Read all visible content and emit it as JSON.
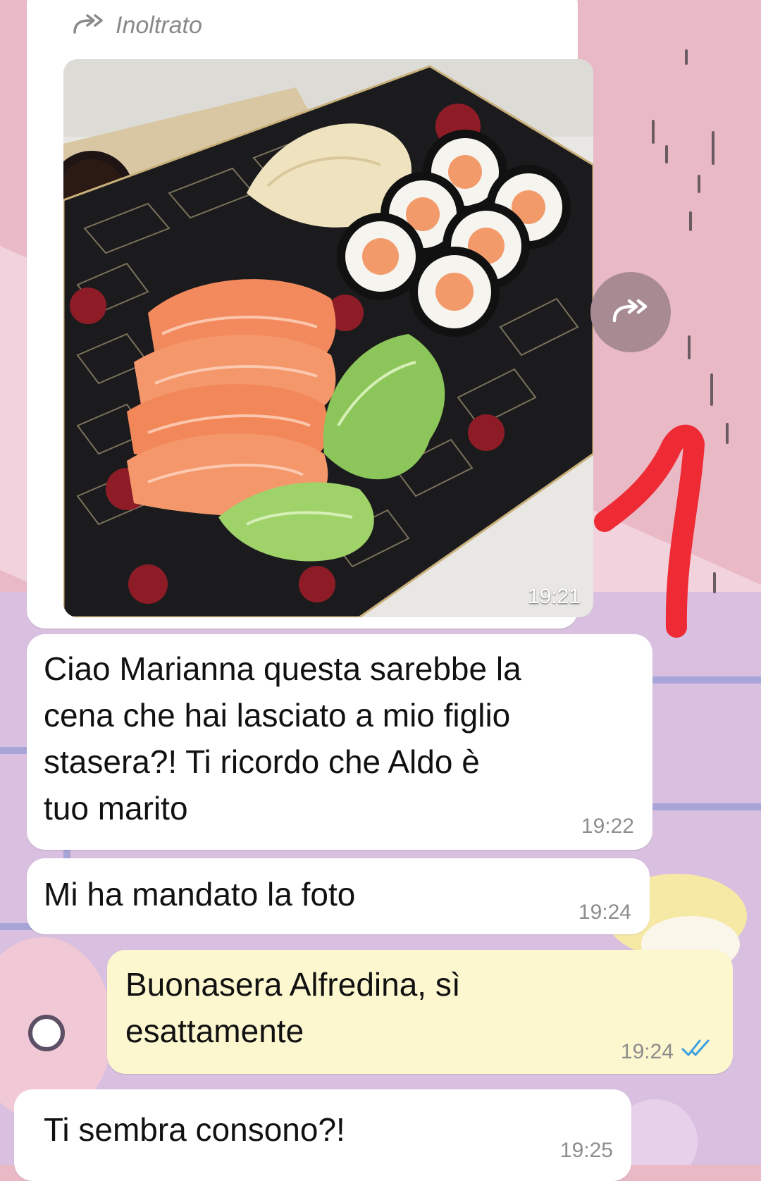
{
  "forwarded": {
    "icon": "forward-icon",
    "label": "Inoltrato",
    "photo_time": "19:21",
    "photo_description_icon": "sushi-photo"
  },
  "forward_button": {
    "icon": "forward-icon"
  },
  "messages": [
    {
      "text": "Ciao Marianna questa sarebbe la\ncena che hai lasciato a mio figlio\nstasera?! Ti ricordo che Aldo è\ntuo marito",
      "time": "19:22",
      "direction": "incoming"
    },
    {
      "text": "Mi ha mandato la foto",
      "time": "19:24",
      "direction": "incoming"
    },
    {
      "text": "Buonasera Alfredina, sì\nesattamente",
      "time": "19:24",
      "direction": "outgoing",
      "status_icon": "double-check-icon",
      "status_color": "#3a9fe0"
    },
    {
      "text": "Ti sembra consono?!",
      "time": "19:25",
      "direction": "incoming"
    }
  ],
  "colors": {
    "incoming_bubble": "#ffffff",
    "outgoing_bubble": "#fdf7cf",
    "annotation_red": "#ee2b35",
    "wallpaper_pink": "#e9b9c6"
  }
}
